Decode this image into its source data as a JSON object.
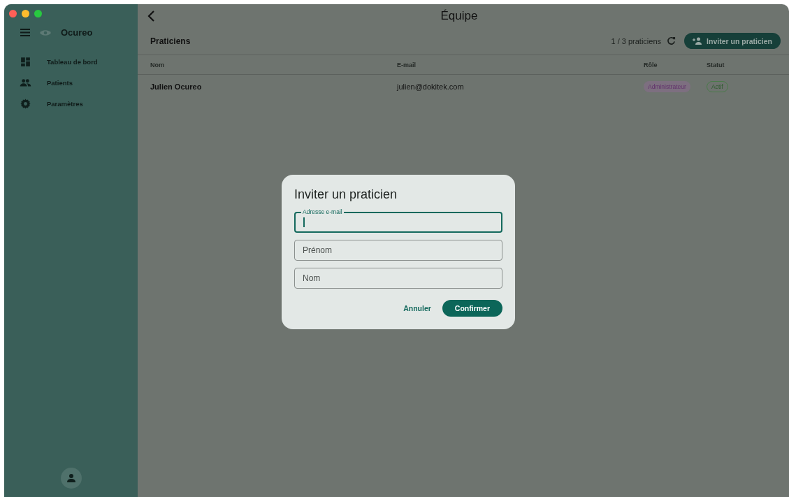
{
  "app": {
    "name": "Ocureo"
  },
  "sidebar": {
    "items": [
      {
        "label": "Tableau de bord"
      },
      {
        "label": "Patients"
      },
      {
        "label": "Paramètres"
      }
    ]
  },
  "page": {
    "title": "Équipe"
  },
  "section": {
    "title": "Praticiens",
    "count": "1 / 3 praticiens",
    "invite_button": "Inviter un praticien"
  },
  "table": {
    "columns": [
      "Nom",
      "E-mail",
      "Rôle",
      "Statut"
    ],
    "rows": [
      {
        "name": "Julien Ocureo",
        "email": "julien@dokitek.com",
        "role": "Administrateur",
        "status": "Actif"
      }
    ]
  },
  "dialog": {
    "title": "Inviter un praticien",
    "fields": [
      {
        "label": "Adresse e-mail",
        "focused": true
      },
      {
        "placeholder": "Prénom",
        "focused": false
      },
      {
        "placeholder": "Nom",
        "focused": false
      }
    ],
    "buttons": [
      {
        "label": "Annuler",
        "kind": "text"
      },
      {
        "label": "Confirmer",
        "kind": "filled"
      }
    ]
  }
}
